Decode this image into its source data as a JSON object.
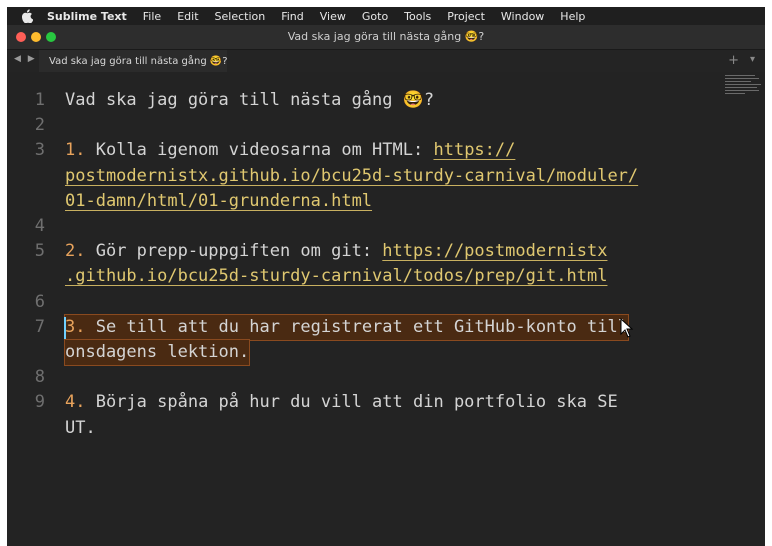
{
  "menubar": {
    "apple_icon": "apple-icon",
    "items": [
      "Sublime Text",
      "File",
      "Edit",
      "Selection",
      "Find",
      "View",
      "Goto",
      "Tools",
      "Project",
      "Window",
      "Help"
    ]
  },
  "window": {
    "title": "Vad ska jag göra till nästa gång 🤓?",
    "tab": {
      "label": "Vad ska jag göra till nästa gång 🤓?",
      "dirty": true
    },
    "new_tab_icon": "+",
    "tab_overflow_icon": "▾"
  },
  "editor": {
    "lines": [
      {
        "ln": "1",
        "parts": [
          {
            "t": "Vad ska jag göra till nästa gång 🤓?",
            "k": "text"
          }
        ]
      },
      {
        "ln": "2",
        "parts": []
      },
      {
        "ln": "3",
        "parts": [
          {
            "t": "1.",
            "k": "num"
          },
          {
            "t": " Kolla igenom videosarna om HTML: ",
            "k": "text"
          },
          {
            "t": "https://",
            "k": "link"
          }
        ]
      },
      {
        "ln": "",
        "parts": [
          {
            "t": "postmodernistx.github.io/bcu25d-sturdy-carnival/moduler/",
            "k": "link"
          }
        ]
      },
      {
        "ln": "",
        "parts": [
          {
            "t": "01-damn/html/01-grunderna.html",
            "k": "link"
          }
        ]
      },
      {
        "ln": "4",
        "parts": []
      },
      {
        "ln": "5",
        "parts": [
          {
            "t": "2.",
            "k": "num"
          },
          {
            "t": " Gör prepp-uppgiften om git: ",
            "k": "text"
          },
          {
            "t": "https://postmodernistx",
            "k": "link"
          }
        ]
      },
      {
        "ln": "",
        "parts": [
          {
            "t": ".github.io/bcu25d-sturdy-carnival/todos/prep/git.html",
            "k": "link"
          }
        ]
      },
      {
        "ln": "6",
        "parts": []
      },
      {
        "ln": "7",
        "parts": [
          {
            "t": "3.",
            "k": "num"
          },
          {
            "t": " Se till att du har registrerat ett GitHub-konto till",
            "k": "text"
          }
        ],
        "highlight": true
      },
      {
        "ln": "",
        "parts": [
          {
            "t": "onsdagens lektion.",
            "k": "text"
          }
        ],
        "highlight": true
      },
      {
        "ln": "8",
        "parts": []
      },
      {
        "ln": "9",
        "parts": [
          {
            "t": "4.",
            "k": "num"
          },
          {
            "t": " Börja spåna på hur du vill att din portfolio ska SE",
            "k": "text"
          }
        ]
      },
      {
        "ln": "",
        "parts": [
          {
            "t": "UT.",
            "k": "text"
          }
        ]
      }
    ]
  },
  "colors": {
    "number": "#e8a35c",
    "link": "#e0c870",
    "selection": "#4a2a12",
    "caret": "#6fd0ff"
  }
}
